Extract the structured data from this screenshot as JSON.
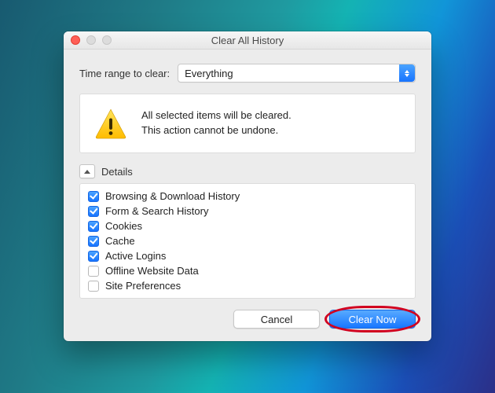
{
  "window": {
    "title": "Clear All History"
  },
  "range": {
    "label": "Time range to clear:",
    "value": "Everything"
  },
  "warning": {
    "line1": "All selected items will be cleared.",
    "line2": "This action cannot be undone."
  },
  "details": {
    "label": "Details",
    "items": [
      {
        "label": "Browsing & Download History",
        "checked": true
      },
      {
        "label": "Form & Search History",
        "checked": true
      },
      {
        "label": "Cookies",
        "checked": true
      },
      {
        "label": "Cache",
        "checked": true
      },
      {
        "label": "Active Logins",
        "checked": true
      },
      {
        "label": "Offline Website Data",
        "checked": false
      },
      {
        "label": "Site Preferences",
        "checked": false
      }
    ]
  },
  "buttons": {
    "cancel": "Cancel",
    "confirm": "Clear Now"
  }
}
